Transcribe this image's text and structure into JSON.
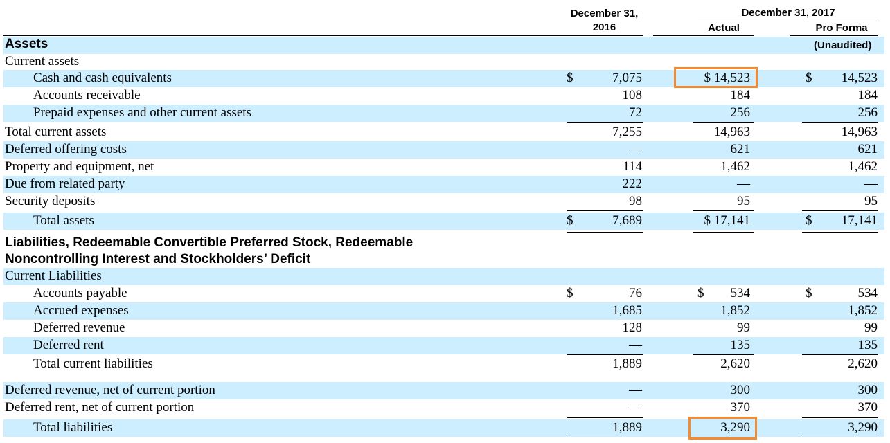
{
  "headers": {
    "col2016_line1": "December 31,",
    "col2016_line2": "2016",
    "col2017_group": "December 31, 2017",
    "col_actual": "Actual",
    "col_proforma": "Pro Forma",
    "unaudited": "(Unaudited)"
  },
  "sections": {
    "assets": "Assets",
    "liab_line1": "Liabilities, Redeemable Convertible Preferred Stock, Redeemable",
    "liab_line2": "Noncontrolling Interest and Stockholders’ Deficit"
  },
  "labels": {
    "current_assets": "Current assets",
    "current_liabilities": "Current Liabilities"
  },
  "dollar_sign": "$",
  "rows": {
    "cash": {
      "label": "Cash and cash equivalents",
      "v2016": "7,075",
      "actual": "$ 14,523",
      "proforma": "14,523"
    },
    "ar": {
      "label": "Accounts receivable",
      "v2016": "108",
      "actual": "184",
      "proforma": "184"
    },
    "prepaid": {
      "label": "Prepaid expenses and other current assets",
      "v2016": "72",
      "actual": "256",
      "proforma": "256"
    },
    "tca": {
      "label": "Total current assets",
      "v2016": "7,255",
      "actual": "14,963",
      "proforma": "14,963"
    },
    "doc": {
      "label": "Deferred offering costs",
      "v2016": "—",
      "actual": "621",
      "proforma": "621"
    },
    "ppe": {
      "label": "Property and equipment, net",
      "v2016": "114",
      "actual": "1,462",
      "proforma": "1,462"
    },
    "drp": {
      "label": "Due from related party",
      "v2016": "222",
      "actual": "—",
      "proforma": "—"
    },
    "sec": {
      "label": "Security deposits",
      "v2016": "98",
      "actual": "95",
      "proforma": "95"
    },
    "ta": {
      "label": "Total assets",
      "v2016": "7,689",
      "actual": "$ 17,141",
      "proforma": "17,141"
    },
    "ap": {
      "label": "Accounts payable",
      "v2016": "76",
      "actual": "534",
      "proforma": "534"
    },
    "accrued": {
      "label": "Accrued expenses",
      "v2016": "1,685",
      "actual": "1,852",
      "proforma": "1,852"
    },
    "defrev": {
      "label": "Deferred revenue",
      "v2016": "128",
      "actual": "99",
      "proforma": "99"
    },
    "defrent": {
      "label": "Deferred rent",
      "v2016": "—",
      "actual": "135",
      "proforma": "135"
    },
    "tcl": {
      "label": "Total current liabilities",
      "v2016": "1,889",
      "actual": "2,620",
      "proforma": "2,620"
    },
    "defrev_nc": {
      "label": "Deferred revenue, net of current portion",
      "v2016": "—",
      "actual": "300",
      "proforma": "300"
    },
    "defrent_nc": {
      "label": "Deferred rent, net of current portion",
      "v2016": "—",
      "actual": "370",
      "proforma": "370"
    },
    "tl": {
      "label": "Total liabilities",
      "v2016": "1,889",
      "actual": "3,290",
      "proforma": "3,290"
    }
  },
  "colors": {
    "shade": "#cceeff",
    "highlight": "#f58a2e"
  }
}
